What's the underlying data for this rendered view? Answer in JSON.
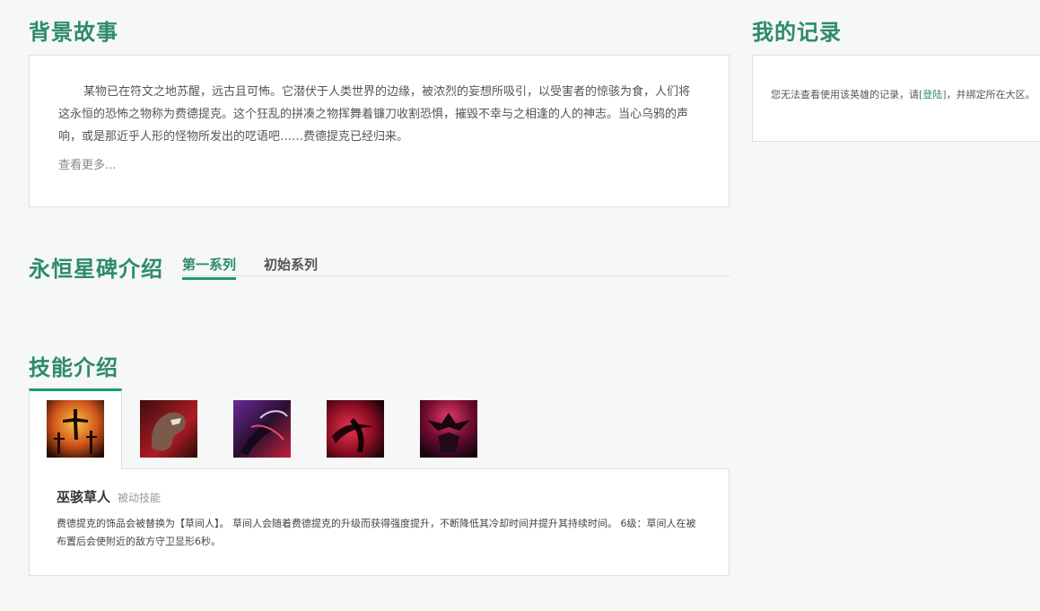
{
  "story": {
    "title": "背景故事",
    "text": "某物已在符文之地苏醒，远古且可怖。它潜伏于人类世界的边缘，被浓烈的妄想所吸引，以受害者的惊骇为食，人们将这永恒的恐怖之物称为费德提克。这个狂乱的拼凑之物挥舞着镰刀收割恐惧，摧毁不幸与之相逢的人的神志。当心乌鸦的声响，或是那近乎人形的怪物所发出的呓语吧……费德提克已经归来。",
    "more": "查看更多..."
  },
  "record": {
    "title": "我的记录",
    "text_before": "您无法查看使用该英雄的记录，请",
    "login_label": "[登陆]",
    "text_after": "，并绑定所在大区。"
  },
  "eternals": {
    "title": "永恒星碑介绍",
    "tabs": [
      {
        "label": "第一系列",
        "active": true
      },
      {
        "label": "初始系列",
        "active": false
      }
    ]
  },
  "skills": {
    "title": "技能介绍",
    "icons": [
      {
        "name": "scarecrow-icon",
        "colors": [
          "#f4a12a",
          "#b5310e",
          "#2a0c05"
        ]
      },
      {
        "name": "terrify-icon",
        "colors": [
          "#c8222c",
          "#5b1a1a",
          "#2b0b0b"
        ]
      },
      {
        "name": "drain-icon",
        "colors": [
          "#8a2db0",
          "#c41f3c",
          "#1b0d25"
        ]
      },
      {
        "name": "flay-icon",
        "colors": [
          "#d1213b",
          "#6a0a1c",
          "#1e0508"
        ]
      },
      {
        "name": "crowstorm-icon",
        "colors": [
          "#c21e49",
          "#5e0a2a",
          "#1b0410"
        ]
      }
    ],
    "selected": {
      "name": "巫骇草人",
      "type": "被动技能",
      "description": "费德提克的饰品会被替换为【草间人】。 草间人会随着费德提克的升级而获得强度提升，不断降低其冷却时间并提升其持续时间。 6级：草间人在被布置后会使附近的敌方守卫显形6秒。"
    }
  },
  "colors": {
    "accent": "#2e8a6e",
    "tab_underline": "#1a9a78"
  }
}
